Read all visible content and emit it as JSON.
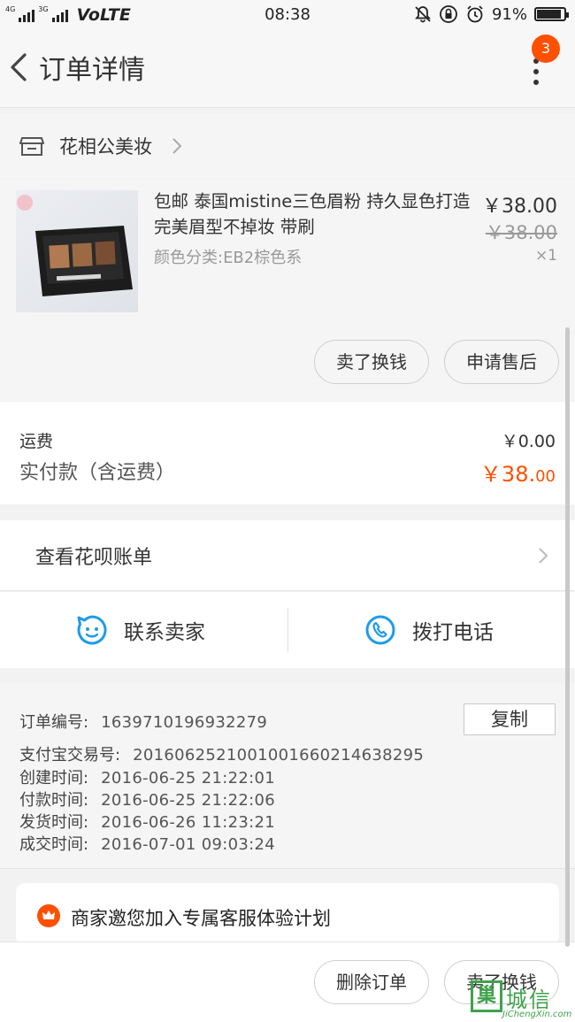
{
  "status_bar": {
    "net_label_1": "4G",
    "net_label_2": "3G",
    "volte": "VoLTE",
    "time": "08:38",
    "battery_percent": "91%",
    "battery_level": 0.91
  },
  "nav": {
    "title": "订单详情",
    "badge": "3"
  },
  "shop": {
    "name": "花相公美妆"
  },
  "product": {
    "title": "包邮 泰国mistine三色眉粉 持久显色打造完美眉型不掉妆 带刷",
    "spec": "颜色分类:EB2棕色系",
    "price": "￥38.00",
    "original_price": "￥38.00",
    "quantity": "×1",
    "sell_label": "卖了换钱",
    "after_sale_label": "申请售后"
  },
  "fees": {
    "shipping_label": "运费",
    "shipping_value": "￥0.00",
    "paid_label": "实付款（含运费）",
    "paid_value_main": "￥38.",
    "paid_value_cents": "00"
  },
  "huabei": {
    "label": "查看花呗账单"
  },
  "contact": {
    "seller_label": "联系卖家",
    "phone_label": "拨打电话"
  },
  "order_info": {
    "copy_label": "复制",
    "rows": [
      {
        "key": "订单编号:",
        "value": "1639710196932279"
      },
      {
        "key": "支付宝交易号:",
        "value": "2016062521001001660214638295"
      },
      {
        "key": "创建时间:",
        "value": "2016-06-25 21:22:01"
      },
      {
        "key": "付款时间:",
        "value": "2016-06-25 21:22:06"
      },
      {
        "key": "发货时间:",
        "value": "2016-06-26 11:23:21"
      },
      {
        "key": "成交时间:",
        "value": "2016-07-01 09:03:24"
      }
    ]
  },
  "service": {
    "text": "商家邀您加入专属客服体验计划"
  },
  "bottom": {
    "delete_label": "删除订单",
    "sell_label": "卖了换钱"
  },
  "watermark": {
    "box_char": "巢",
    "text": "城信",
    "sub": "JiChengXin.com"
  },
  "colors": {
    "accent": "#ff5000",
    "icon_blue": "#1e9be9",
    "watermark_green": "#3fa24b"
  }
}
